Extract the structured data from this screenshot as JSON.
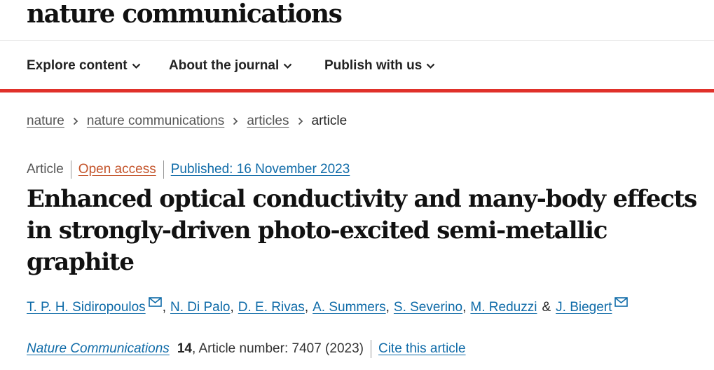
{
  "header": {
    "logo": "nature communications"
  },
  "nav": {
    "items": [
      {
        "label": "Explore content"
      },
      {
        "label": "About the journal"
      },
      {
        "label": "Publish with us"
      }
    ]
  },
  "breadcrumb": {
    "items": [
      "nature",
      "nature communications",
      "articles"
    ],
    "current": "article"
  },
  "article": {
    "type": "Article",
    "access": "Open access",
    "published": "Published: 16 November 2023",
    "title": "Enhanced optical conductivity and many-body effects in strongly-driven photo-excited semi-metallic graphite",
    "authors": [
      {
        "name": "T. P. H. Sidiropoulos",
        "email_icon": true
      },
      {
        "name": "N. Di Palo",
        "email_icon": false
      },
      {
        "name": "D. E. Rivas",
        "email_icon": false
      },
      {
        "name": "A. Summers",
        "email_icon": false
      },
      {
        "name": "S. Severino",
        "email_icon": false
      },
      {
        "name": "M. Reduzzi",
        "email_icon": false
      },
      {
        "name": "J. Biegert",
        "email_icon": true
      }
    ],
    "author_separator": ",",
    "author_last_joiner": "&",
    "journal": "Nature Communications",
    "volume": "14",
    "citation_detail": ", Article number: 7407 (2023)",
    "cite_label": "Cite this article"
  },
  "colors": {
    "accent_red": "#e0312a",
    "link_blue": "#0f6ba8",
    "open_access_orange": "#c4542b"
  },
  "icons": {
    "nav_dropdown": "chevron-down-icon",
    "breadcrumb_separator": "chevron-right-icon",
    "author_contact": "envelope-icon"
  }
}
